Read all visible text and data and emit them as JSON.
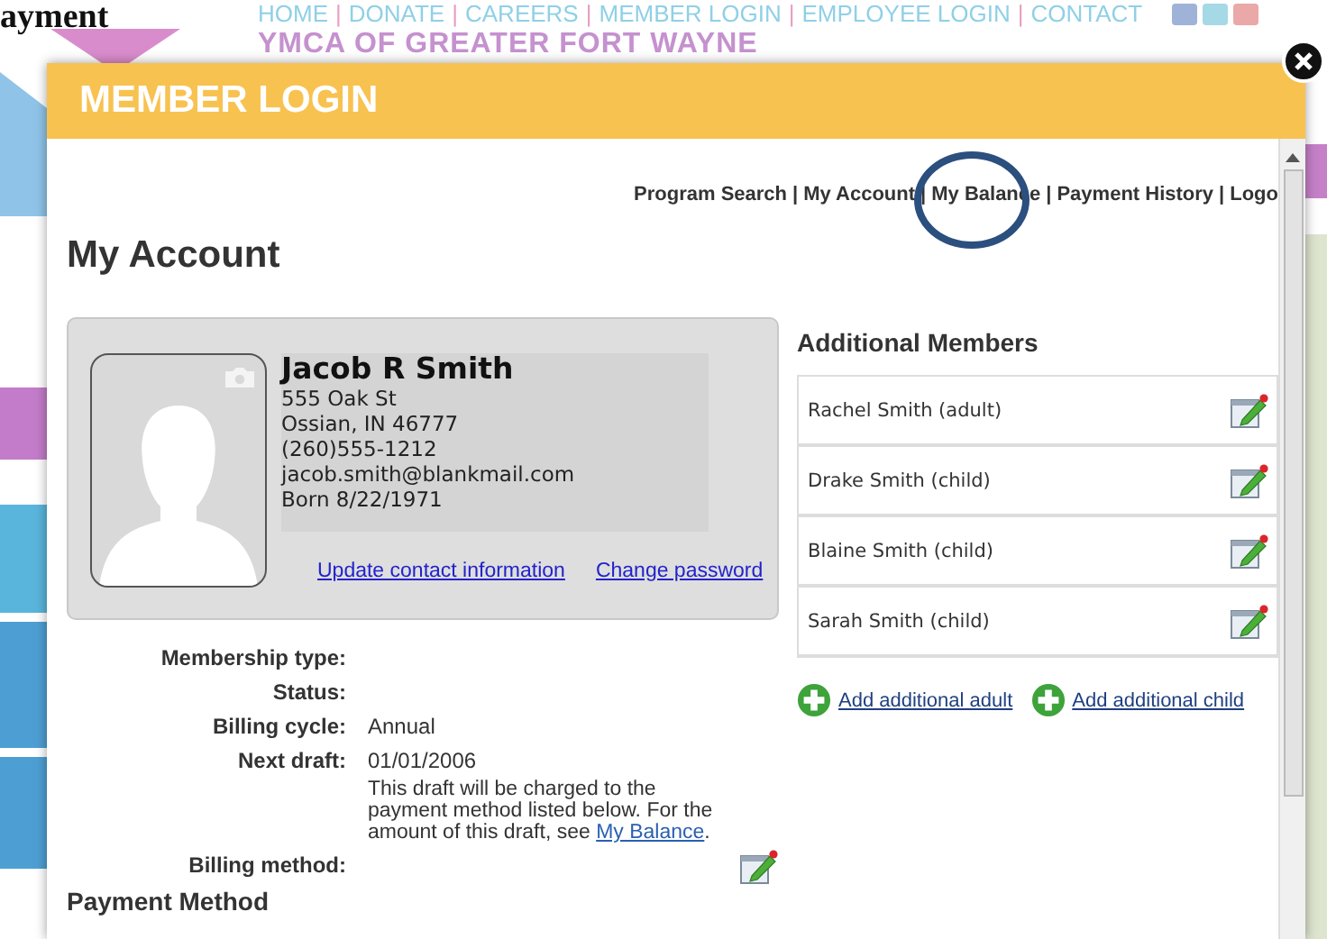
{
  "page_title": "ayment",
  "site_nav": {
    "separator": "|",
    "links": [
      "HOME",
      "DONATE",
      "CAREERS",
      "MEMBER LOGIN",
      "EMPLOYEE LOGIN",
      "CONTACT"
    ]
  },
  "site_name": "YMCA OF GREATER FORT WAYNE",
  "dialog": {
    "title": "MEMBER LOGIN",
    "separator": "|",
    "top_links": [
      {
        "label": "Program Search",
        "circled": false
      },
      {
        "label": "My Account",
        "circled": false
      },
      {
        "label": "My Balance",
        "circled": true
      },
      {
        "label": "Payment History",
        "circled": false
      },
      {
        "label": "Logo",
        "circled": false
      }
    ],
    "heading": "My Account",
    "profile": {
      "name": "Jacob R Smith",
      "lines": [
        "555 Oak St",
        "Ossian, IN 46777",
        "(260)555-1212",
        "jacob.smith@blankmail.com",
        "Born 8/22/1971"
      ],
      "links": [
        "Update contact information",
        "Change password"
      ]
    },
    "details": [
      {
        "label": "Membership type:"
      },
      {
        "label": "Status:"
      },
      {
        "label": "Billing cycle:",
        "value": "Annual"
      },
      {
        "label": "Next draft:",
        "value": "01/01/2006",
        "note": {
          "text": "This draft will be charged to the payment method listed below. For the amount of this draft, see ",
          "link": "My Balance",
          "end": "."
        }
      },
      {
        "label": "Billing method:",
        "editable": true
      }
    ],
    "section_heading": "Payment Method",
    "additional_members": {
      "title": "Additional Members",
      "members": [
        "Rachel Smith (adult)",
        "Drake Smith (child)",
        "Blaine Smith (child)",
        "Sarah Smith (child)"
      ],
      "actions": [
        "Add additional adult",
        "Add additional child"
      ]
    }
  }
}
